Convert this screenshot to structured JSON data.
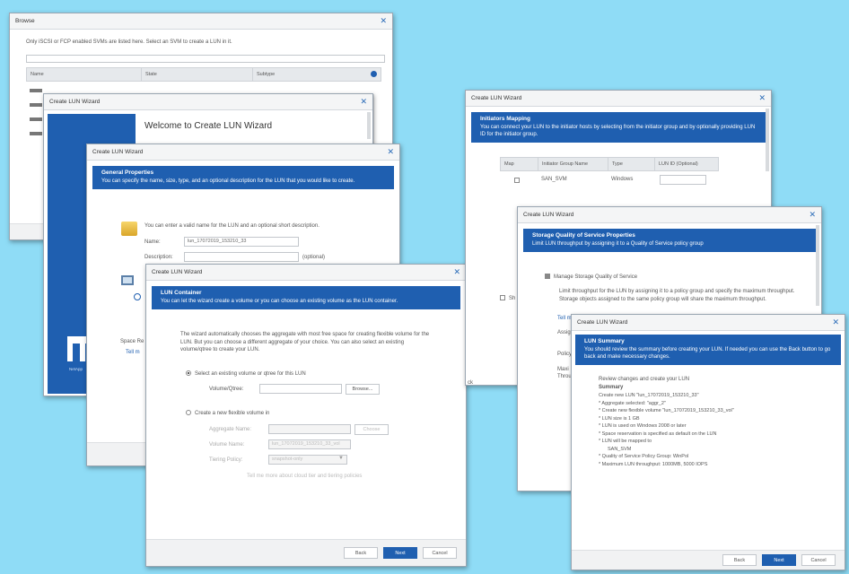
{
  "browse": {
    "title": "Browse",
    "info": "Only iSCSI or FCP enabled SVMs are listed here. Select an SVM to create a LUN in it.",
    "columns": [
      "Name",
      "State",
      "Subtype"
    ]
  },
  "welcome": {
    "title": "Create LUN Wizard",
    "heading": "Welcome to Create LUN Wizard",
    "side_text": "Space Re",
    "side_link": "Tell m",
    "logo_text": "NetApp"
  },
  "general": {
    "title": "Create LUN Wizard",
    "banner_title": "General Properties",
    "banner_desc": "You can specify the name, size, type, and an optional description for the LUN that you would like to create.",
    "intro": "You can enter a valid name for the LUN and an optional short description.",
    "name_label": "Name:",
    "name_value": "lun_17072019_153210_33",
    "desc_label": "Description:",
    "optional": "(optional)",
    "footer_left": "ok"
  },
  "container": {
    "title": "Create LUN Wizard",
    "banner_title": "LUN Container",
    "banner_desc": "You can let the wizard create a volume or you can choose an existing volume as the LUN container.",
    "intro": "The wizard automatically chooses the aggregate with most free space for creating flexible volume for the LUN. But you can choose a different aggregate of your choice. You can also select an existing volume/qtree to create your LUN.",
    "opt_existing": "Select an existing volume or qtree for this LUN",
    "volume_label": "Volume/Qtree:",
    "browse_btn": "Browse...",
    "opt_new": "Create a new flexible volume in",
    "aggr_label": "Aggregate Name:",
    "choose_btn": "Choose",
    "volname_label": "Volume Name:",
    "volname_value": "lun_17072019_153210_33_vol",
    "tiering_label": "Tiering Policy:",
    "tiering_value": "snapshot-only",
    "tell_more": "Tell me more about cloud tier and tiering policies",
    "back": "Back",
    "next": "Next",
    "cancel": "Cancel"
  },
  "mapping": {
    "title": "Create LUN Wizard",
    "banner_title": "Initiators Mapping",
    "banner_desc": "You can connect your LUN to the initiator hosts by selecting from the initiator group and by optionally providing LUN ID for the initiator group.",
    "columns": [
      "Map",
      "Initiator Group Name",
      "Type",
      "LUN ID (Optional)"
    ],
    "row_name": "SAN_SVM",
    "row_type": "Windows",
    "left_text": "Sh",
    "bottom_left": "ck"
  },
  "qos": {
    "title": "Create LUN Wizard",
    "banner_title": "Storage Quality of Service Properties",
    "banner_desc": "Limit LUN throughput by assigning it to a Quality of Service policy group",
    "manage_label": "Manage Storage Quality of Service",
    "desc": "Limit throughput for the LUN by assigning it to a policy group and specify the maximum throughput. Storage objects assigned to the same policy group will share the maximum throughput.",
    "tell_me": "Tell m",
    "assign": "Assig",
    "policy": "Policy",
    "maxi": "Maxi",
    "through": "Throu"
  },
  "summary": {
    "title": "Create LUN Wizard",
    "banner_title": "LUN Summary",
    "banner_desc": "You should review the summary before creating your LUN. If needed you can use the Back button to go back and make necessary changes.",
    "review": "Review changes and create your LUN",
    "summary_label": "Summary",
    "lines": [
      "Create new LUN \"lun_17072019_153210_33\"",
      "* Aggregate selected: \"aggr_2\"",
      "* Create new flexible volume \"lun_17072019_153210_33_vol\"",
      "* LUN size is 1 GB",
      "* LUN is used on Windows 2008 or later",
      "* Space reservation is specified as default on the LUN",
      "* LUN will be mapped to",
      "SAN_SVM",
      "* Quality of Service Policy Group: WinPol",
      "* Maximum LUN throughput: 1000MB, 5000 IOPS"
    ],
    "back": "Back",
    "next": "Next",
    "cancel": "Cancel"
  }
}
